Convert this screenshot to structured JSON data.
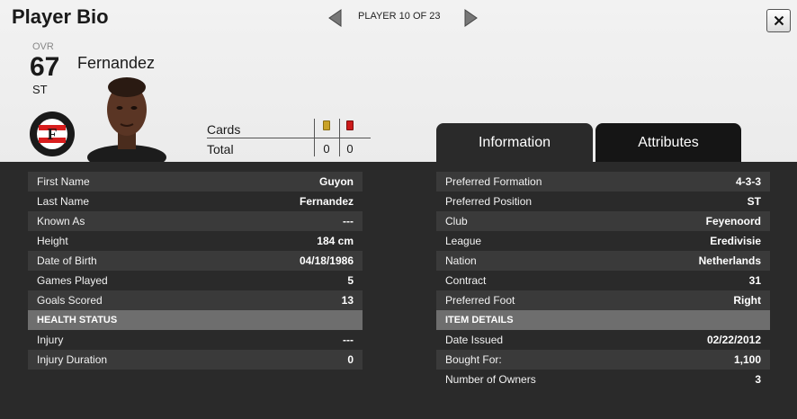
{
  "header": {
    "title": "Player Bio",
    "nav_text": "PLAYER 10 OF 23",
    "close_label": "X"
  },
  "player": {
    "ovr_label": "OVR",
    "ovr_value": "67",
    "position": "ST",
    "name": "Fernandez"
  },
  "cards": {
    "cards_label": "Cards",
    "total_label": "Total",
    "yellow_total": "0",
    "red_total": "0",
    "yellow_color": "#c9a227",
    "red_color": "#cc1a1a"
  },
  "tabs": {
    "information": "Information",
    "attributes": "Attributes"
  },
  "left": {
    "rows": [
      {
        "label": "First Name",
        "value": "Guyon"
      },
      {
        "label": "Last Name",
        "value": "Fernandez"
      },
      {
        "label": "Known As",
        "value": "---"
      },
      {
        "label": "Height",
        "value": "184 cm"
      },
      {
        "label": "Date of Birth",
        "value": "04/18/1986"
      },
      {
        "label": "Games Played",
        "value": "5"
      },
      {
        "label": "Goals Scored",
        "value": "13"
      }
    ],
    "section": "HEALTH STATUS",
    "rows2": [
      {
        "label": "Injury",
        "value": "---"
      },
      {
        "label": "Injury Duration",
        "value": "0"
      }
    ]
  },
  "right": {
    "rows": [
      {
        "label": "Preferred Formation",
        "value": "4-3-3"
      },
      {
        "label": "Preferred Position",
        "value": "ST"
      },
      {
        "label": "Club",
        "value": "Feyenoord"
      },
      {
        "label": "League",
        "value": "Eredivisie"
      },
      {
        "label": "Nation",
        "value": "Netherlands"
      },
      {
        "label": "Contract",
        "value": "31"
      },
      {
        "label": "Preferred Foot",
        "value": "Right"
      }
    ],
    "section": "ITEM DETAILS",
    "rows2": [
      {
        "label": "Date Issued",
        "value": "02/22/2012"
      },
      {
        "label": "Bought For:",
        "value": "1,100"
      },
      {
        "label": "Number of Owners",
        "value": "3"
      }
    ]
  },
  "icons": {
    "prev": "triangle-left-icon",
    "next": "triangle-right-icon",
    "close": "close-icon",
    "club_badge": "feyenoord-badge"
  },
  "badge_text": "FEYENOORD ROTTERDAM"
}
